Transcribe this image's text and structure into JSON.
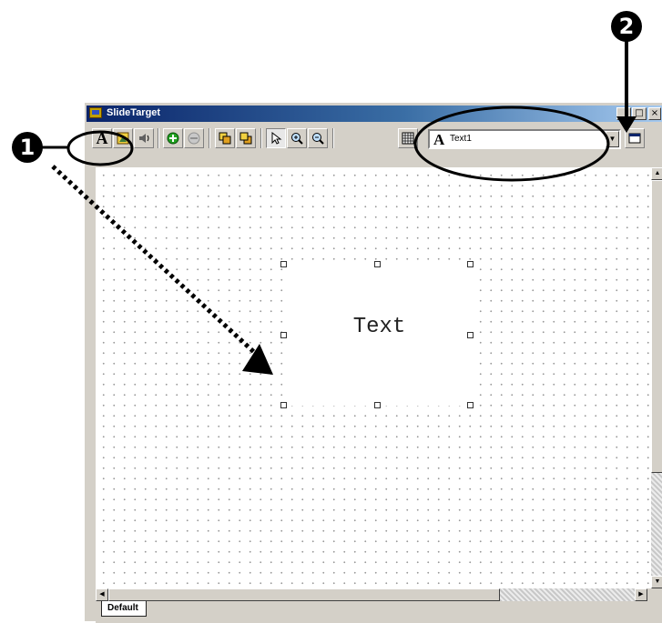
{
  "window": {
    "title": "SlideTarget"
  },
  "toolbar": {
    "text_tool": "A",
    "object_selector": {
      "icon": "A",
      "value": "Text1"
    }
  },
  "canvas": {
    "text_object": "Text"
  },
  "tabs": [
    {
      "label": "Default"
    }
  ],
  "callouts": [
    {
      "number": "1"
    },
    {
      "number": "2"
    }
  ],
  "colors": {
    "title_start": "#0a246a",
    "title_end": "#a6caf0",
    "face": "#d4d0c8"
  }
}
